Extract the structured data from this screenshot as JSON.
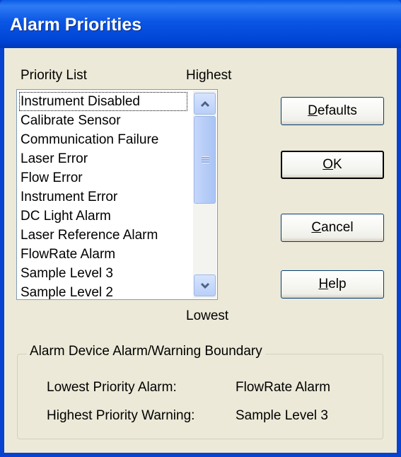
{
  "window": {
    "title": "Alarm Priorities"
  },
  "labels": {
    "priority_list": "Priority List",
    "highest": "Highest",
    "lowest": "Lowest"
  },
  "priority_list": {
    "items": [
      "Instrument Disabled",
      "Calibrate Sensor",
      "Communication Failure",
      "Laser Error",
      "Flow Error",
      "Instrument Error",
      "DC Light Alarm",
      "Laser Reference Alarm",
      "FlowRate Alarm",
      "Sample Level 3",
      "Sample Level 2"
    ],
    "focused_item": "Instrument Disabled"
  },
  "buttons": {
    "defaults": {
      "mnemonic": "D",
      "rest": "efaults"
    },
    "ok": {
      "mnemonic": "O",
      "rest": "K"
    },
    "cancel": {
      "mnemonic": "C",
      "rest": "ancel"
    },
    "help": {
      "mnemonic": "H",
      "rest": "elp"
    }
  },
  "boundary": {
    "title": "Alarm Device Alarm/Warning  Boundary",
    "lowest_alarm_label": "Lowest Priority Alarm:",
    "lowest_alarm_value": "FlowRate Alarm",
    "highest_warning_label": "Highest Priority Warning:",
    "highest_warning_value": "Sample Level 3"
  },
  "colors": {
    "titlebar": "#0a56e4",
    "dialog_bg": "#ece9d8",
    "button_border": "#003c74"
  }
}
